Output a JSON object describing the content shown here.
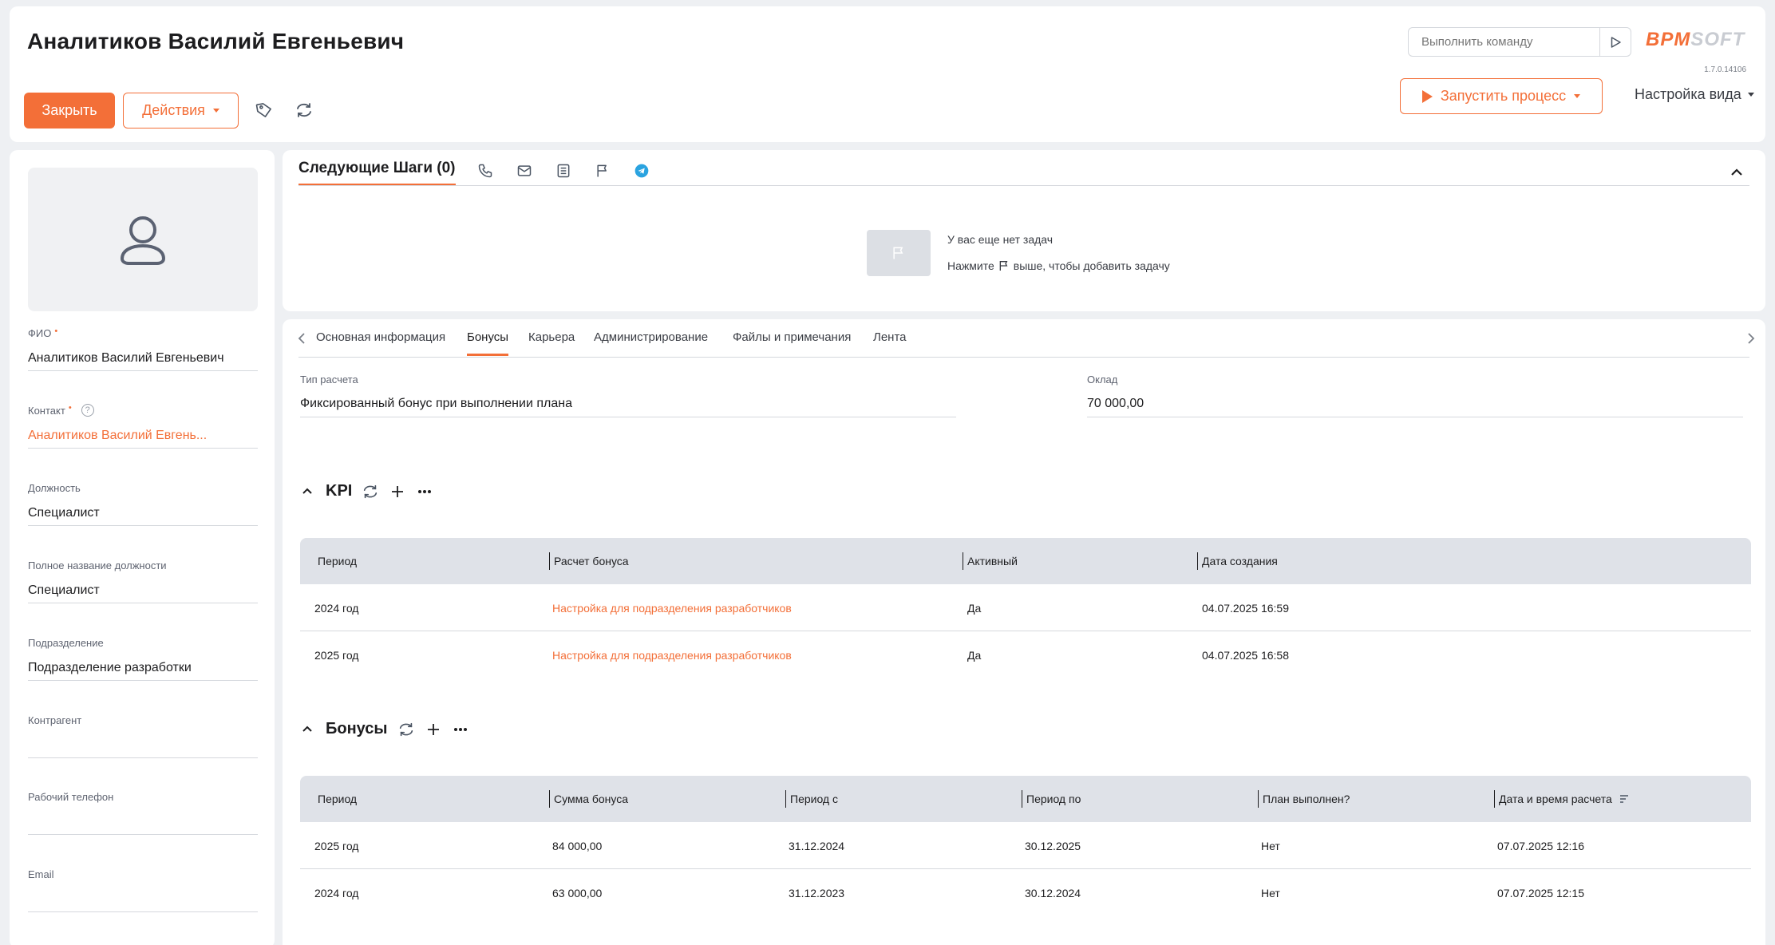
{
  "header": {
    "title": "Аналитиков Василий Евгеньевич",
    "close_label": "Закрыть",
    "actions_label": "Действия",
    "command_placeholder": "Выполнить команду",
    "logo_part1": "BPM",
    "logo_part2": "SOFT",
    "version": "1.7.0.14106",
    "process_label": "Запустить процесс",
    "view_settings_label": "Настройка вида"
  },
  "sidebar": {
    "fields": [
      {
        "label": "ФИО",
        "required": true,
        "value": "Аналитиков Василий Евгеньевич"
      },
      {
        "label": "Контакт",
        "required": true,
        "value": "Аналитиков Василий Евгень..."
      },
      {
        "label": "Должность",
        "value": "Специалист"
      },
      {
        "label": "Полное название должности",
        "value": "Специалист"
      },
      {
        "label": "Подразделение",
        "value": "Подразделение разработки"
      },
      {
        "label": "Контрагент",
        "value": ""
      },
      {
        "label": "Рабочий телефон",
        "value": ""
      },
      {
        "label": "Email",
        "value": ""
      }
    ]
  },
  "steps": {
    "title": "Следующие Шаги (0)",
    "empty_line1": "У вас еще нет задач",
    "empty_line2_before": "Нажмите",
    "empty_line2_after": "выше, чтобы добавить задачу"
  },
  "tabs": [
    "Основная информация",
    "Бонусы",
    "Карьера",
    "Администрирование",
    "Файлы и примечания",
    "Лента"
  ],
  "main": {
    "calc_type_label": "Тип расчета",
    "calc_type_value": "Фиксированный бонус при выполнении плана",
    "salary_label": "Оклад",
    "salary_value": "70 000,00"
  },
  "kpi": {
    "title": "KPI",
    "columns": [
      "Период",
      "Расчет бонуса",
      "Активный",
      "Дата создания"
    ],
    "rows": [
      [
        "2024 год",
        "Настройка для подразделения разработчиков",
        "Да",
        "04.07.2025 16:59"
      ],
      [
        "2025 год",
        "Настройка для подразделения разработчиков",
        "Да",
        "04.07.2025 16:58"
      ]
    ]
  },
  "bonuses": {
    "title": "Бонусы",
    "columns": [
      "Период",
      "Сумма бонуса",
      "Период с",
      "Период по",
      "План выполнен?",
      "Дата и время расчета"
    ],
    "rows": [
      [
        "2025 год",
        "84 000,00",
        "31.12.2024",
        "30.12.2025",
        "Нет",
        "07.07.2025 12:16"
      ],
      [
        "2024 год",
        "63 000,00",
        "31.12.2023",
        "30.12.2024",
        "Нет",
        "07.07.2025 12:15"
      ]
    ]
  },
  "colors": {
    "accent": "#f36f38",
    "background": "#eef0f3",
    "grid_header": "#dfe2e8",
    "telegram": "#2aa3e0"
  },
  "icons": {
    "tag": "tag-icon",
    "refresh": "refresh-icon",
    "run": "play-icon",
    "phone": "phone-icon",
    "email": "envelope-icon",
    "note": "document-icon",
    "task": "flag-icon",
    "telegram": "telegram-icon",
    "avatar": "user-placeholder-icon"
  }
}
